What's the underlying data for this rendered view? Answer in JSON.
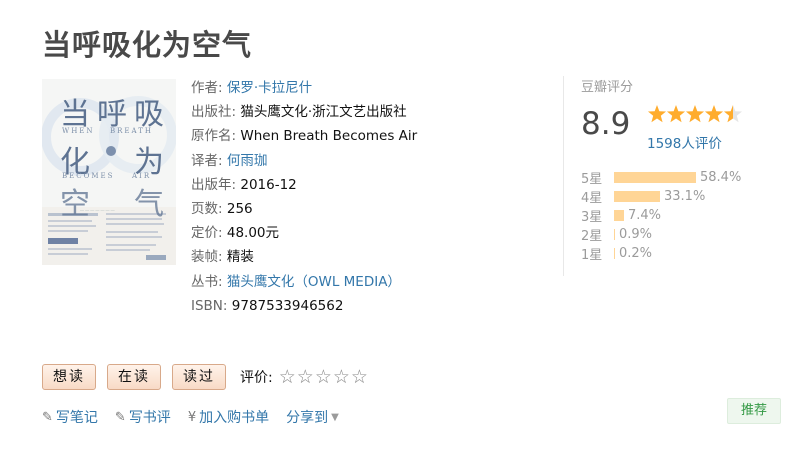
{
  "book": {
    "title": "当呼吸化为空气",
    "cover": {
      "title_chars": [
        "当",
        "呼",
        "吸",
        "化",
        "为",
        "空",
        "气"
      ],
      "english": [
        "WHEN",
        "BREATH",
        "BECOMES",
        "AIR"
      ]
    },
    "meta": [
      {
        "label": "作者:",
        "value": "保罗·卡拉尼什",
        "link": true
      },
      {
        "label": "出版社:",
        "value": "猫头鹰文化·浙江文艺出版社",
        "link": false
      },
      {
        "label": "原作名:",
        "value": "When Breath Becomes Air",
        "link": false
      },
      {
        "label": "译者:",
        "value": "何雨珈",
        "link": true
      },
      {
        "label": "出版年:",
        "value": "2016-12",
        "link": false
      },
      {
        "label": "页数:",
        "value": "256",
        "link": false
      },
      {
        "label": "定价:",
        "value": "48.00元",
        "link": false
      },
      {
        "label": "装帧:",
        "value": "精装",
        "link": false
      },
      {
        "label": "丛书:",
        "value": "猫头鹰文化（OWL MEDIA）",
        "link": true
      },
      {
        "label": "ISBN:",
        "value": "9787533946562",
        "link": false
      }
    ]
  },
  "rating": {
    "label": "豆瓣评分",
    "score": "8.9",
    "stars_value": 4.5,
    "count_text": "1598人评价",
    "star_color": "#ffac2d",
    "bar_color": "#ffd596",
    "distribution": [
      {
        "label": "5星",
        "percent": 58.4,
        "text": "58.4%"
      },
      {
        "label": "4星",
        "percent": 33.1,
        "text": "33.1%"
      },
      {
        "label": "3星",
        "percent": 7.4,
        "text": "7.4%"
      },
      {
        "label": "2星",
        "percent": 0.9,
        "text": "0.9%"
      },
      {
        "label": "1星",
        "percent": 0.2,
        "text": "0.2%"
      }
    ]
  },
  "actions": {
    "want": "想读",
    "reading": "在读",
    "read": "读过",
    "rate_label": "评价:",
    "empty_star": "☆"
  },
  "tools": {
    "note": "写笔记",
    "review": "写书评",
    "cart": "加入购书单",
    "share": "分享到",
    "pencil_glyph": "✎",
    "yen_glyph": "¥",
    "caret_glyph": "▼"
  },
  "recommend": "推荐",
  "link_color": "#3377aa"
}
